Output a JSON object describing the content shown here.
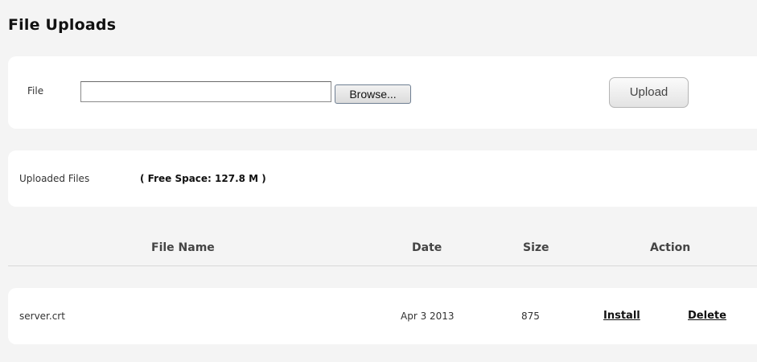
{
  "page": {
    "title": "File Uploads"
  },
  "upload": {
    "file_label": "File",
    "file_value": "",
    "browse_label": "Browse...",
    "upload_label": "Upload"
  },
  "files_section": {
    "label": "Uploaded Files",
    "free_space": "( Free Space: 127.8 M )"
  },
  "table": {
    "headers": {
      "name": "File Name",
      "date": "Date",
      "size": "Size",
      "action": "Action"
    },
    "rows": [
      {
        "name": "server.crt",
        "date": "Apr 3 2013",
        "size": "875",
        "install_label": "Install",
        "delete_label": "Delete"
      }
    ]
  }
}
